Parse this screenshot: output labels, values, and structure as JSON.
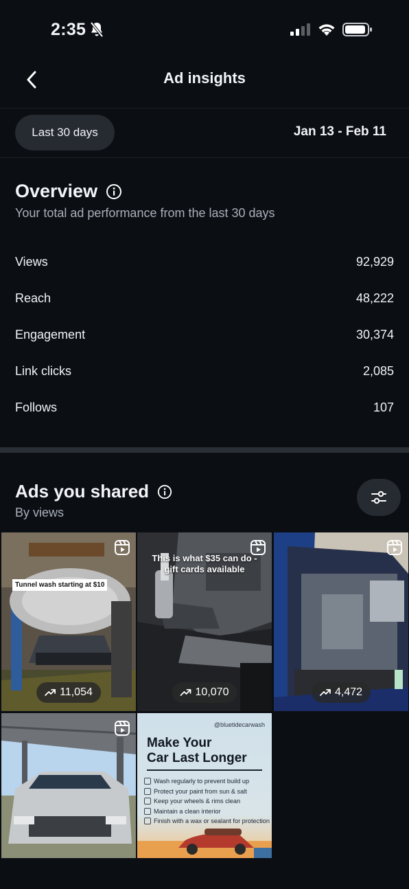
{
  "status_bar": {
    "time": "2:35"
  },
  "nav": {
    "title": "Ad insights"
  },
  "date_range": {
    "chip_label": "Last 30 days",
    "dates": "Jan 13 - Feb 11"
  },
  "overview": {
    "title": "Overview",
    "subtitle": "Your total ad performance from the last 30 days",
    "metrics": [
      {
        "label": "Views",
        "value": "92,929"
      },
      {
        "label": "Reach",
        "value": "48,222"
      },
      {
        "label": "Engagement",
        "value": "30,374"
      },
      {
        "label": "Link clicks",
        "value": "2,085"
      },
      {
        "label": "Follows",
        "value": "107"
      }
    ]
  },
  "ads": {
    "title": "Ads you shared",
    "subtitle": "By views",
    "items": [
      {
        "views": "11,054",
        "overlay": "Tunnel wash starting at $10"
      },
      {
        "views": "10,070",
        "overlay": "This is what $35 can do - gift cards available"
      },
      {
        "views": "4,472",
        "overlay": ""
      },
      {
        "views": "",
        "overlay": ""
      },
      {
        "views": "",
        "handle": "@bluetidecarwash",
        "title_line1": "Make Your",
        "title_line2": "Car Last Longer",
        "tips": [
          "Wash regularly to prevent build up",
          "Protect your paint from sun & salt",
          "Keep your wheels & rims clean",
          "Maintain a clean interior",
          "Finish with a wax or sealant for protection"
        ]
      }
    ]
  },
  "icons": [
    "bell-slash-icon",
    "signal-icon",
    "wifi-icon",
    "battery-icon",
    "back-chevron-icon",
    "info-icon",
    "filter-sliders-icon",
    "reel-icon",
    "trending-up-icon"
  ],
  "colors": {
    "background": "#0b0e13",
    "chip": "#262a31",
    "divider": "#2a2f36",
    "secondary_text": "#a9b0ba"
  }
}
